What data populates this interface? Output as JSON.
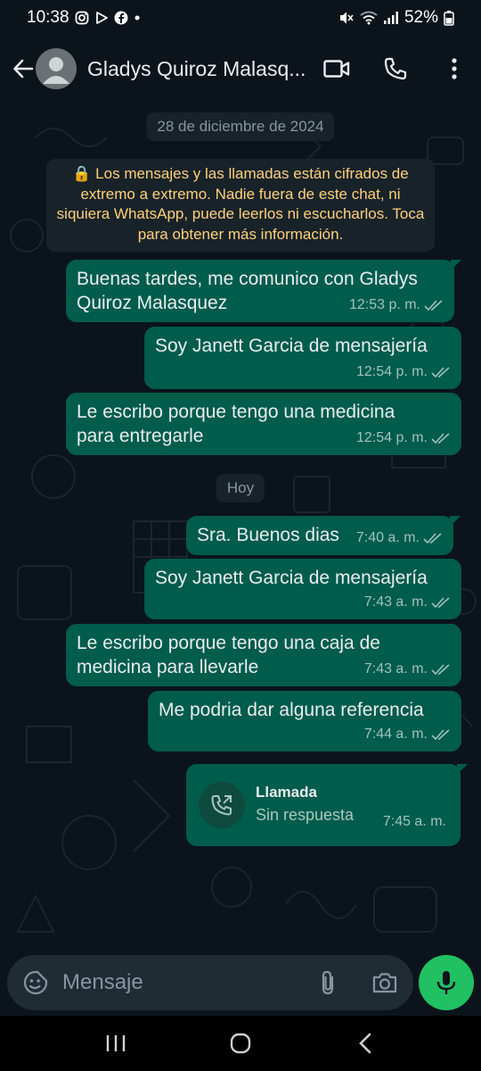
{
  "status_bar": {
    "time": "10:38",
    "battery": "52%",
    "icons": [
      "instagram-icon",
      "play-icon",
      "facebook-icon",
      "dot-icon",
      "mute-icon",
      "wifi-icon",
      "signal-icon",
      "battery-icon"
    ]
  },
  "header": {
    "contact_name": "Gladys Quiroz Malasq...",
    "icons": [
      "back-arrow-icon",
      "avatar-icon",
      "video-call-icon",
      "phone-icon",
      "more-vert-icon"
    ]
  },
  "chat": {
    "date_divider_1": "28 de diciembre de 2024",
    "encryption_notice": "🔒 Los mensajes y las llamadas están cifrados de extremo a extremo. Nadie fuera de este chat, ni siquiera WhatsApp, puede leerlos ni escucharlos. Toca para obtener más información.",
    "date_divider_2": "Hoy",
    "messages": [
      {
        "text": "Buenas tardes, me comunico con Gladys Quiroz Malasquez",
        "time": "12:53 p. m."
      },
      {
        "text": "Soy Janett Garcia de mensajería",
        "time": "12:54 p. m."
      },
      {
        "text": "Le escribo porque tengo una medicina para entregarle",
        "time": "12:54 p. m."
      },
      {
        "text": "Sra. Buenos dias",
        "time": "7:40 a. m."
      },
      {
        "text": "Soy Janett Garcia de mensajería",
        "time": "7:43 a. m."
      },
      {
        "text": "Le escribo porque tengo una caja de medicina para llevarle",
        "time": "7:43 a. m."
      },
      {
        "text": "Me podria dar alguna referencia",
        "time": "7:44 a. m."
      }
    ],
    "call": {
      "title": "Llamada",
      "status": "Sin respuesta",
      "time": "7:45 a. m."
    }
  },
  "input": {
    "placeholder": "Mensaje"
  },
  "colors": {
    "background": "#0b141a",
    "outgoing_bubble": "#005c4b",
    "notice_text": "#ffd279",
    "mic_button": "#21c063"
  }
}
